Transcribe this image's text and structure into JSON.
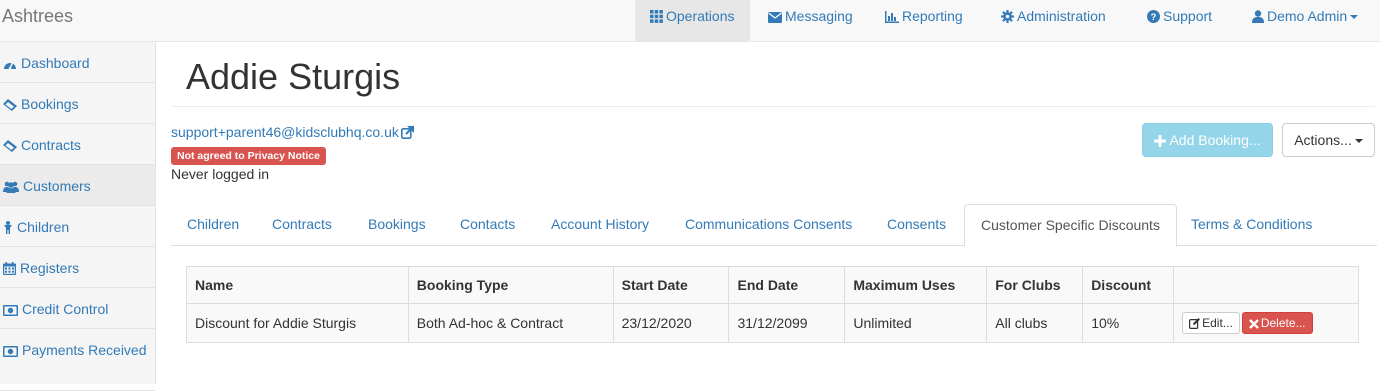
{
  "app": {
    "brand": "Ashtrees"
  },
  "topnav": {
    "operations": "Operations",
    "messaging": "Messaging",
    "reporting": "Reporting",
    "administration": "Administration",
    "support": "Support",
    "user": "Demo Admin"
  },
  "sidebar": {
    "items": [
      {
        "label": "Dashboard",
        "icon": "dashboard-icon"
      },
      {
        "label": "Bookings",
        "icon": "ticket-icon"
      },
      {
        "label": "Contracts",
        "icon": "ticket-icon"
      },
      {
        "label": "Customers",
        "icon": "users-icon"
      },
      {
        "label": "Children",
        "icon": "child-icon"
      },
      {
        "label": "Registers",
        "icon": "calendar-icon"
      },
      {
        "label": "Credit Control",
        "icon": "money-icon"
      },
      {
        "label": "Payments Received",
        "icon": "money-icon"
      }
    ]
  },
  "customer": {
    "name": "Addie Sturgis",
    "email": "support+parent46@kidsclubhq.co.uk",
    "privacy_badge": "Not agreed to Privacy Notice",
    "login_status": "Never logged in"
  },
  "actions": {
    "add_booking": "Add Booking...",
    "actions": "Actions..."
  },
  "tabs": [
    "Children",
    "Contracts",
    "Bookings",
    "Contacts",
    "Account History",
    "Communications Consents",
    "Consents",
    "Customer Specific Discounts",
    "Terms & Conditions"
  ],
  "active_tab": "Customer Specific Discounts",
  "discounts": {
    "columns": [
      "Name",
      "Booking Type",
      "Start Date",
      "End Date",
      "Maximum Uses",
      "For Clubs",
      "Discount",
      ""
    ],
    "rows": [
      {
        "name": "Discount for Addie Sturgis",
        "booking_type": "Both Ad-hoc & Contract",
        "start_date": "23/12/2020",
        "end_date": "31/12/2099",
        "max_uses": "Unlimited",
        "for_clubs": "All clubs",
        "discount": "10%",
        "edit_label": "Edit...",
        "delete_label": "Delete..."
      }
    ]
  },
  "colors": {
    "link": "#337ab7",
    "danger": "#d9534f",
    "info": "#5bc0de"
  }
}
